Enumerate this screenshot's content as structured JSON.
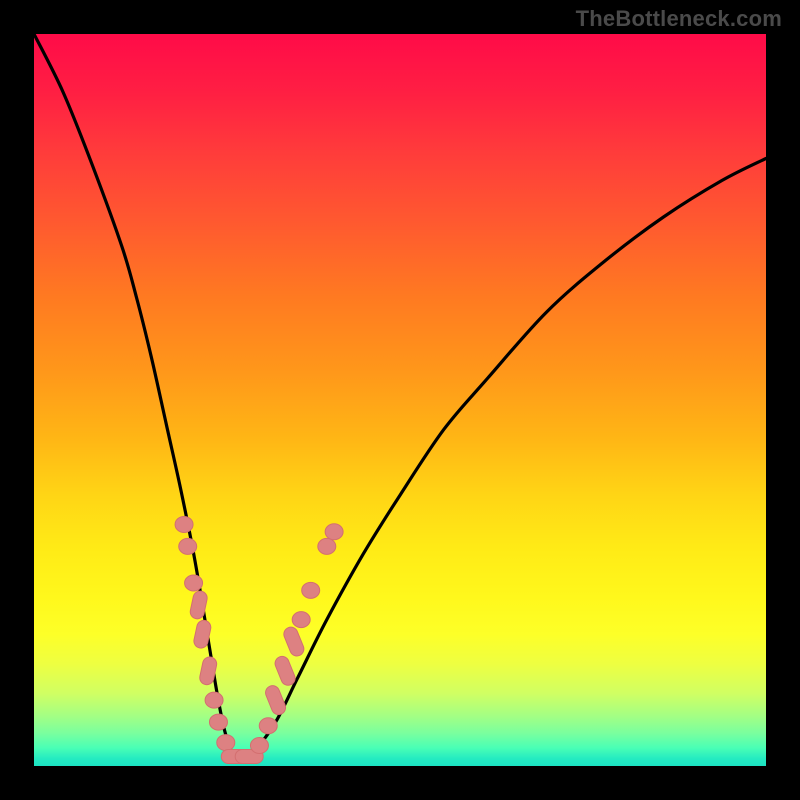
{
  "watermark": "TheBottleneck.com",
  "colors": {
    "frame": "#000000",
    "curve": "#000000",
    "marker_fill": "#dd8182",
    "marker_stroke": "#d36f70"
  },
  "chart_data": {
    "type": "line",
    "title": "",
    "xlabel": "",
    "ylabel": "",
    "xlim": [
      0,
      100
    ],
    "ylim": [
      0,
      100
    ],
    "grid": false,
    "series": [
      {
        "name": "bottleneck-curve",
        "x": [
          0,
          4,
          8,
          12,
          14,
          16,
          18,
          20,
          22,
          24,
          25,
          26,
          27,
          28,
          30,
          33,
          36,
          40,
          45,
          50,
          56,
          62,
          70,
          78,
          86,
          94,
          100
        ],
        "y": [
          100,
          92,
          82,
          71,
          64,
          56,
          47,
          38,
          28,
          16,
          10,
          5,
          2,
          1,
          2,
          6,
          12,
          20,
          29,
          37,
          46,
          53,
          62,
          69,
          75,
          80,
          83
        ]
      }
    ],
    "markers": [
      {
        "x": 20.5,
        "y": 33,
        "shape": "round"
      },
      {
        "x": 21.0,
        "y": 30,
        "shape": "round"
      },
      {
        "x": 21.8,
        "y": 25,
        "shape": "round"
      },
      {
        "x": 22.5,
        "y": 22,
        "shape": "pill-v"
      },
      {
        "x": 23.0,
        "y": 18,
        "shape": "pill-v"
      },
      {
        "x": 23.8,
        "y": 13,
        "shape": "pill-v"
      },
      {
        "x": 24.6,
        "y": 9,
        "shape": "round"
      },
      {
        "x": 25.2,
        "y": 6,
        "shape": "round"
      },
      {
        "x": 26.2,
        "y": 3.2,
        "shape": "round"
      },
      {
        "x": 27.5,
        "y": 1.3,
        "shape": "pill-h"
      },
      {
        "x": 29.4,
        "y": 1.3,
        "shape": "pill-h"
      },
      {
        "x": 30.8,
        "y": 2.8,
        "shape": "round"
      },
      {
        "x": 32.0,
        "y": 5.5,
        "shape": "round"
      },
      {
        "x": 33.0,
        "y": 9,
        "shape": "pill-d"
      },
      {
        "x": 34.3,
        "y": 13,
        "shape": "pill-d"
      },
      {
        "x": 35.5,
        "y": 17,
        "shape": "pill-d"
      },
      {
        "x": 36.5,
        "y": 20,
        "shape": "round"
      },
      {
        "x": 37.8,
        "y": 24,
        "shape": "round"
      },
      {
        "x": 40.0,
        "y": 30,
        "shape": "round"
      },
      {
        "x": 41.0,
        "y": 32,
        "shape": "round"
      }
    ],
    "notes": "Axes are unlabeled in the source image; x and y are expressed as 0–100 percentages of the plot area. y=0 is the bottom (green) edge, y=100 is the top (red) edge. The curve dips to a minimum near x≈28 then rises toward the right edge."
  }
}
